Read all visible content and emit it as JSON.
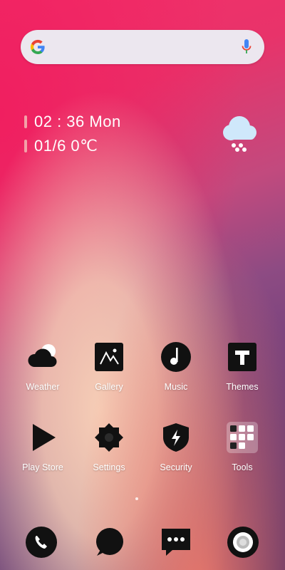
{
  "search": {
    "placeholder": ""
  },
  "clock": {
    "time": "02 : 36 Mon",
    "date": "01/6 0℃"
  },
  "apps": [
    {
      "label": "Weather",
      "icon": "weather-icon"
    },
    {
      "label": "Gallery",
      "icon": "gallery-icon"
    },
    {
      "label": "Music",
      "icon": "music-icon"
    },
    {
      "label": "Themes",
      "icon": "themes-icon"
    },
    {
      "label": "Play Store",
      "icon": "play-store-icon"
    },
    {
      "label": "Settings",
      "icon": "settings-icon"
    },
    {
      "label": "Security",
      "icon": "security-icon"
    },
    {
      "label": "Tools",
      "icon": "tools-icon"
    }
  ],
  "dock": [
    {
      "icon": "phone-icon"
    },
    {
      "icon": "messages-bubble-icon"
    },
    {
      "icon": "chat-icon"
    },
    {
      "icon": "camera-icon"
    }
  ],
  "colors": {
    "clock_bar": "#f3a1a8",
    "icon_fill": "#111111"
  }
}
